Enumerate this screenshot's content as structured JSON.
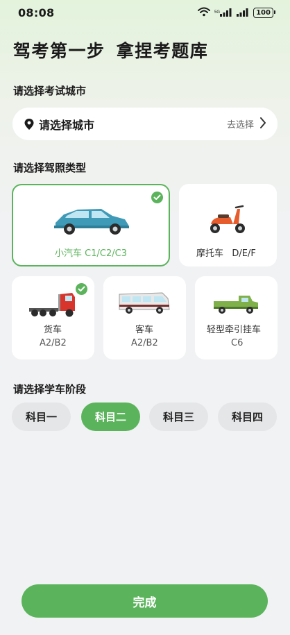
{
  "status_bar": {
    "time": "08:08",
    "battery": "100",
    "icons": [
      "wifi-icon",
      "signal-icon",
      "signal-icon",
      "battery-icon"
    ]
  },
  "headline": "驾考第一步 拿捏考题库",
  "city": {
    "section_label": "请选择考试城市",
    "field_label": "请选择城市",
    "action_label": "去选择",
    "icons": [
      "location-pin-icon",
      "chevron-right-icon"
    ]
  },
  "license": {
    "section_label": "请选择驾照类型",
    "types": [
      {
        "name": "小汽车",
        "code": "C1/C2/C3",
        "selected": true,
        "icon": "car-icon"
      },
      {
        "name": "摩托车",
        "code": "D/E/F",
        "selected": false,
        "icon": "scooter-icon"
      },
      {
        "name": "货车",
        "code": "A2/B2",
        "selected": true,
        "icon": "truck-icon"
      },
      {
        "name": "客车",
        "code": "A2/B2",
        "selected": false,
        "icon": "bus-icon"
      },
      {
        "name": "轻型牵引挂车",
        "code": "C6",
        "selected": false,
        "icon": "pickup-icon"
      }
    ]
  },
  "stage": {
    "section_label": "请选择学车阶段",
    "options": [
      "科目一",
      "科目二",
      "科目三",
      "科目四"
    ],
    "active": "科目二"
  },
  "done_label": "完成",
  "colors": {
    "accent": "#5bb45c",
    "background": "#f1f2f4",
    "pill_inactive": "#e5e6e8"
  }
}
